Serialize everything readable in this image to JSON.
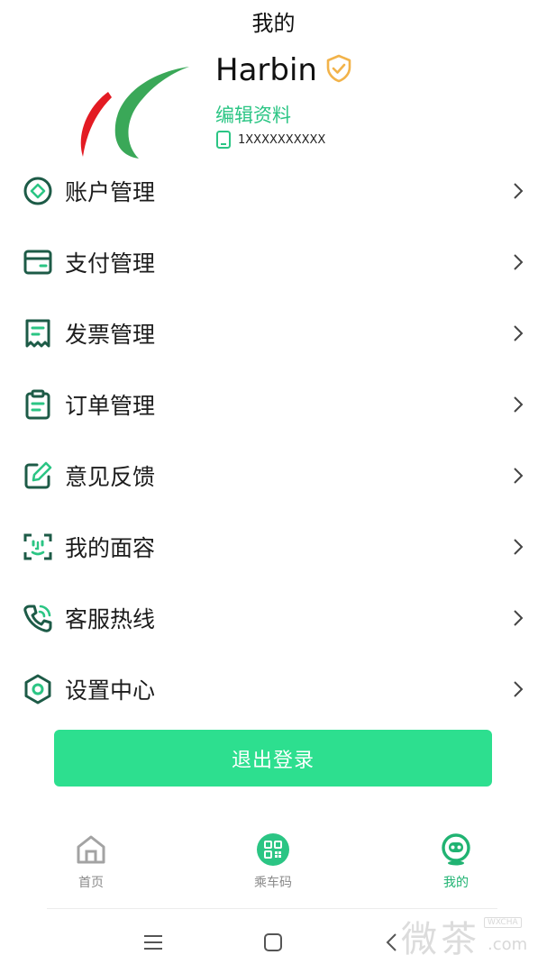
{
  "page": {
    "title": "我的"
  },
  "profile": {
    "username": "Harbin",
    "edit_label": "编辑资料",
    "phone": "1XXXXXXXXXX",
    "verified_icon": "shield-check-icon"
  },
  "menu": {
    "items": [
      {
        "label": "账户管理",
        "icon": "account-icon"
      },
      {
        "label": "支付管理",
        "icon": "wallet-icon"
      },
      {
        "label": "发票管理",
        "icon": "invoice-icon"
      },
      {
        "label": "订单管理",
        "icon": "clipboard-icon"
      },
      {
        "label": "意见反馈",
        "icon": "edit-icon"
      },
      {
        "label": "我的面容",
        "icon": "face-scan-icon"
      },
      {
        "label": "客服热线",
        "icon": "phone-call-icon"
      },
      {
        "label": "设置中心",
        "icon": "settings-icon"
      }
    ]
  },
  "logout": {
    "label": "退出登录"
  },
  "tabbar": {
    "tabs": [
      {
        "label": "首页",
        "icon": "home-icon",
        "active": false
      },
      {
        "label": "乘车码",
        "icon": "qr-code-icon",
        "active": false
      },
      {
        "label": "我的",
        "icon": "profile-robot-icon",
        "active": true
      }
    ]
  },
  "watermark": {
    "text": "微茶",
    "badge": "WXCHA",
    "suffix": ".com"
  },
  "colors": {
    "accent": "#2ddf8f",
    "accent_text": "#2bc584",
    "icon": "#1d5b47",
    "badge": "#f2b34a"
  }
}
